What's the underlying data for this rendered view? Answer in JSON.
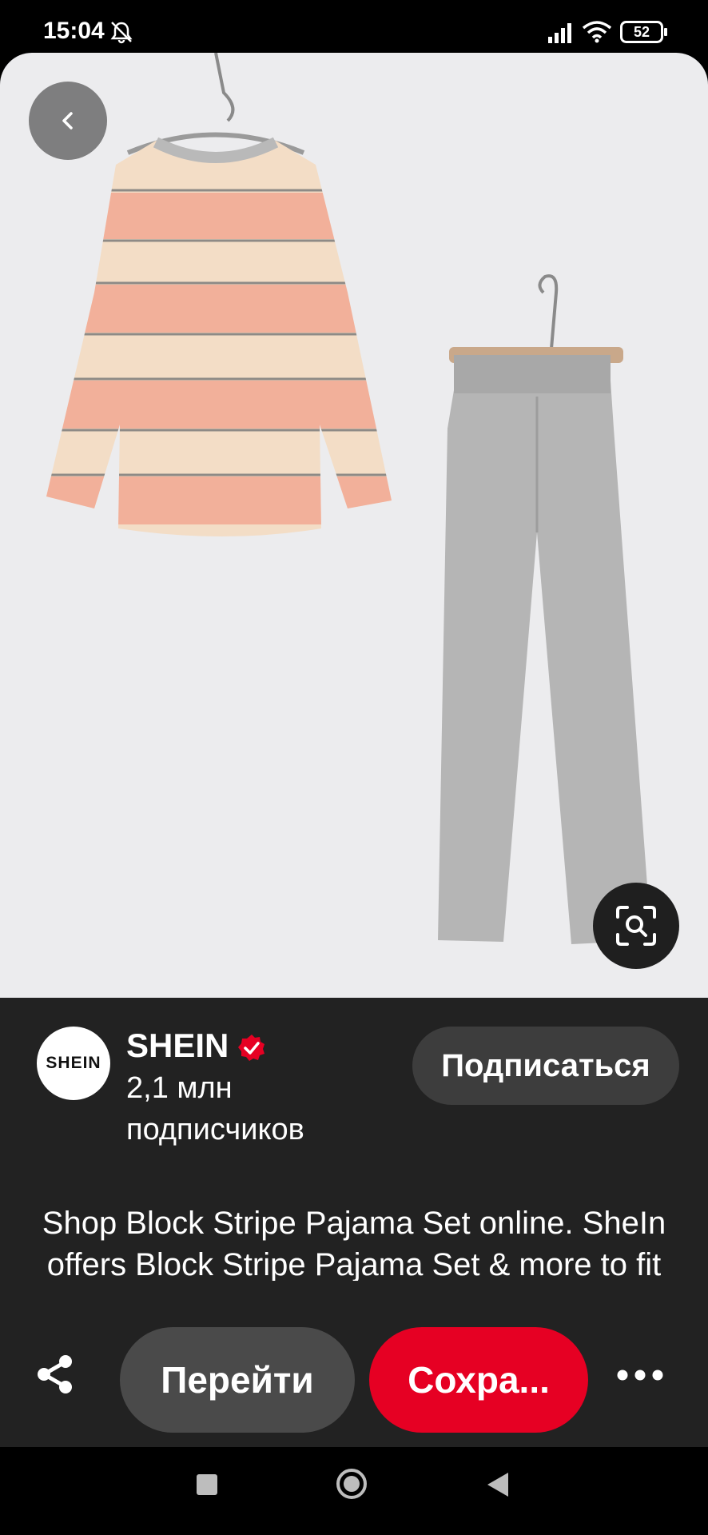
{
  "status_bar": {
    "time": "15:04",
    "battery": "52"
  },
  "pin": {
    "brand_name": "SHEIN",
    "avatar_logo": "SHEIN",
    "followers_count": "2,1 млн",
    "followers_label": "подписчиков",
    "subscribe_label": "Подписаться",
    "description": "Shop Block Stripe Pajama Set online. SheIn offers Block Stripe Pajama Set & more to fit your fashionable needs."
  },
  "actions": {
    "go_label": "Перейти",
    "save_label": "Сохра..."
  },
  "icons": {
    "back": "chevron-left-icon",
    "lens": "visual-search-icon",
    "share": "share-icon",
    "more": "more-horizontal-icon",
    "verified": "verified-badge-icon"
  },
  "colors": {
    "save_red": "#e60023",
    "panel_bg": "#222222",
    "photo_bg": "#ececee"
  }
}
